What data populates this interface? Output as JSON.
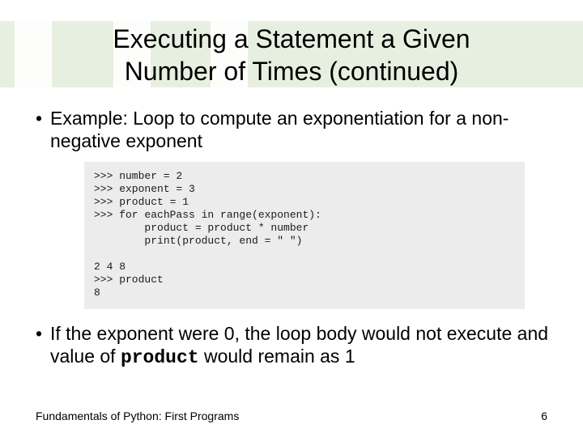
{
  "title_line1": "Executing a Statement a Given",
  "title_line2": "Number of Times (continued)",
  "bullet1": "Example: Loop to compute an exponentiation for a non-negative exponent",
  "code": ">>> number = 2\n>>> exponent = 3\n>>> product = 1\n>>> for eachPass in range(exponent):\n        product = product * number\n        print(product, end = \" \")\n\n2 4 8\n>>> product\n8",
  "bullet2_pre": "If the exponent were 0, the loop body would not execute and value of ",
  "bullet2_code": "product",
  "bullet2_post": " would remain as 1",
  "footer_left": "Fundamentals of Python: First Programs",
  "footer_right": "6"
}
